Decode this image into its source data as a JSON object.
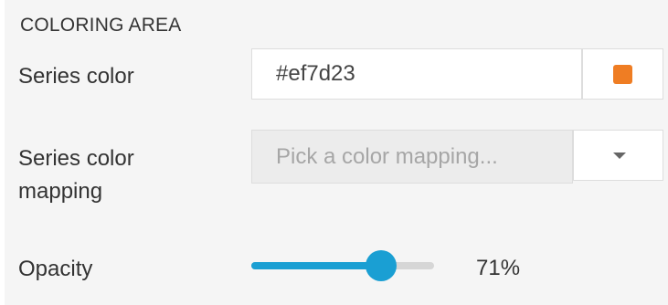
{
  "section": {
    "title": "COLORING AREA"
  },
  "series_color": {
    "label": "Series color",
    "value": "#ef7d23",
    "swatch_color": "#ef7d23",
    "swatch_icon": "color-swatch"
  },
  "series_color_mapping": {
    "label": "Series color mapping",
    "placeholder": "Pick a color mapping...",
    "dropdown_icon": "caret-down"
  },
  "opacity": {
    "label": "Opacity",
    "value": 0.71,
    "value_label": "71%",
    "accent_color": "#1a9fd3"
  }
}
